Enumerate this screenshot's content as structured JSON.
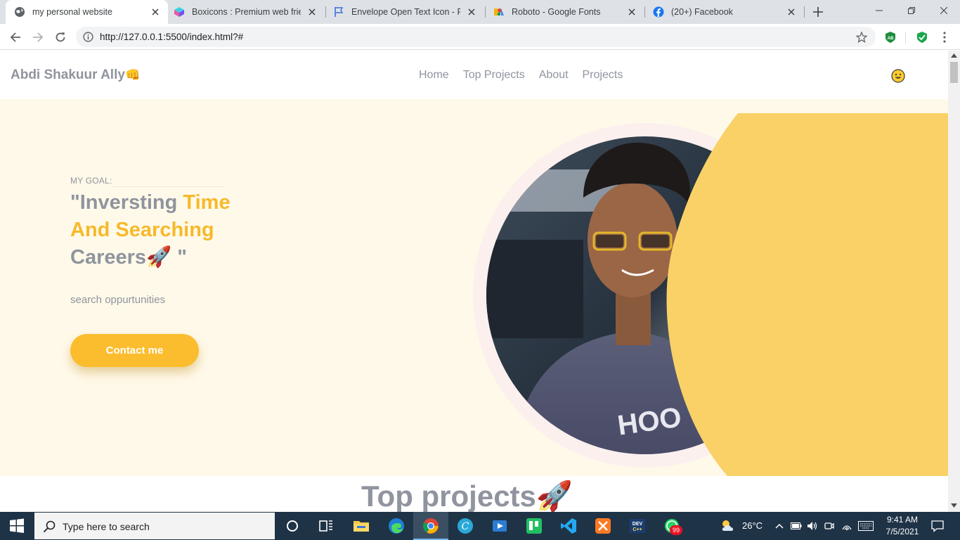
{
  "browser": {
    "tabs": [
      {
        "title": "my personal website",
        "icon": "globe-icon",
        "active": true
      },
      {
        "title": "Boxicons : Premium web friendly",
        "icon": "boxicons-icon",
        "active": false
      },
      {
        "title": "Envelope Open Text Icon - Regular",
        "icon": "flag-icon",
        "active": false
      },
      {
        "title": "Roboto - Google Fonts",
        "icon": "google-fonts-icon",
        "active": false
      },
      {
        "title": "(20+) Facebook",
        "icon": "facebook-icon",
        "active": false
      }
    ],
    "url": "http://127.0.0.1:5500/index.html?#"
  },
  "site": {
    "logo_text": "Abdi Shakuur Ally",
    "logo_emoji": "👊",
    "nav": [
      "Home",
      "Top Projects",
      "About",
      "Projects"
    ],
    "hero": {
      "label": "MY GOAL:",
      "headline_part1": "\"Inversting ",
      "headline_hl": "Time And Searching",
      "headline_part2": "Careers",
      "headline_emoji": "🚀",
      "headline_close": " \"",
      "subtitle": "search oppurtunities",
      "cta": "Contact me"
    },
    "section_title": "Top projects",
    "section_emoji": "🚀"
  },
  "taskbar": {
    "search_placeholder": "Type here to search",
    "temperature": "26°C",
    "time": "9:41 AM",
    "date": "7/5/2021",
    "whatsapp_badge": "99"
  },
  "colors": {
    "accent": "#fbbd2e",
    "hero_bg": "#fff9e9",
    "text_muted": "#8f949e",
    "shape_yellow": "#fad167"
  }
}
